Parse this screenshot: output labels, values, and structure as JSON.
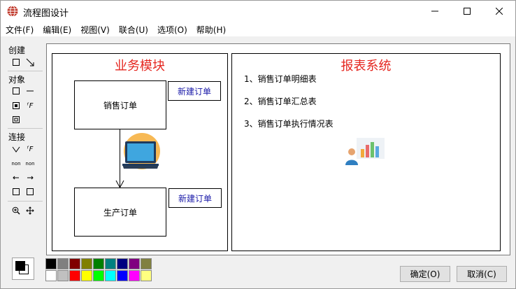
{
  "window": {
    "title": "流程图设计",
    "controls": {
      "minimize": "—",
      "maximize": "☐",
      "close": "✕"
    }
  },
  "menu": [
    "文件(F)",
    "编辑(E)",
    "视图(V)",
    "联合(U)",
    "选项(O)",
    "帮助(H)"
  ],
  "toolbox": {
    "sections": [
      "创建",
      "对象",
      "连接"
    ],
    "tool_text": {
      "text_tool": "ᶠF",
      "text_tool_2": "ᶠF",
      "non_a": "non",
      "non_b": "non"
    }
  },
  "canvas": {
    "left_panel": {
      "title": "业务模块",
      "node_top": "销售订单",
      "node_bottom": "生产订单",
      "link_top": "新建订单",
      "link_bottom": "新建订单"
    },
    "right_panel": {
      "title": "报表系统",
      "items": [
        "1、销售订单明细表",
        "2、销售订单汇总表",
        "3、销售订单执行情况表"
      ]
    }
  },
  "palette": [
    "#000000",
    "#808080",
    "#800000",
    "#808000",
    "#008000",
    "#008080",
    "#000080",
    "#800080",
    "#808040",
    "#ffffff",
    "#c0c0c0",
    "#ff0000",
    "#ffff00",
    "#00ff00",
    "#00ffff",
    "#0000ff",
    "#ff00ff",
    "#ffff80"
  ],
  "buttons": {
    "ok": "确定(O)",
    "cancel": "取消(C)"
  },
  "colors": {
    "title_red": "#e5261f",
    "link_blue": "#1a1aa8"
  }
}
